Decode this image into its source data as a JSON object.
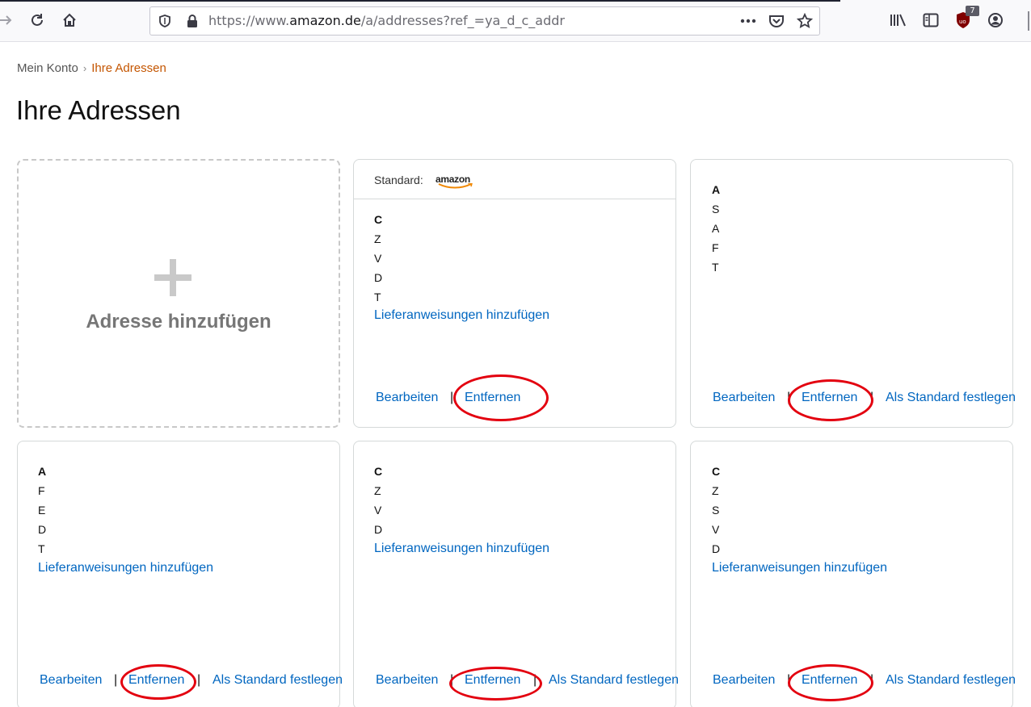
{
  "browser": {
    "url_prefix": "https://www.",
    "url_domain": "amazon.de",
    "url_suffix": "/a/addresses?ref_=ya_d_c_addr",
    "ublock_count": "7"
  },
  "breadcrumb": {
    "root": "Mein Konto",
    "separator": "›",
    "current": "Ihre Adressen"
  },
  "page_title": "Ihre Adressen",
  "add_card": {
    "label": "Adresse hinzufügen"
  },
  "default_header": {
    "label": "Standard:",
    "logo_text": "amazon"
  },
  "cards": [
    {
      "lines": [
        "C",
        "Z",
        "V",
        "D",
        "T"
      ],
      "instructions_link": "Lieferanweisungen hinzufügen",
      "edit": "Bearbeiten",
      "remove": "Entfernen",
      "set_default": ""
    },
    {
      "lines": [
        "A",
        "S",
        "A",
        "F",
        "T"
      ],
      "instructions_link": "",
      "edit": "Bearbeiten",
      "remove": "Entfernen",
      "set_default": "Als Standard festlegen"
    },
    {
      "lines": [
        "A",
        "F",
        "E",
        "D",
        "T"
      ],
      "instructions_link": "Lieferanweisungen hinzufügen",
      "edit": "Bearbeiten",
      "remove": "Entfernen",
      "set_default": "Als Standard festlegen"
    },
    {
      "lines": [
        "C",
        "Z",
        "V",
        "D"
      ],
      "instructions_link": "Lieferanweisungen hinzufügen",
      "edit": "Bearbeiten",
      "remove": "Entfernen",
      "set_default": "Als Standard festlegen"
    },
    {
      "lines": [
        "C",
        "Z",
        "S",
        "V",
        "D"
      ],
      "instructions_link": "Lieferanweisungen hinzufügen",
      "edit": "Bearbeiten",
      "remove": "Entfernen",
      "set_default": "Als Standard festlegen"
    }
  ],
  "pipe": "|",
  "colors": {
    "link": "#0066c0",
    "breadcrumb_current": "#c45500",
    "annotation": "#e3000f"
  }
}
